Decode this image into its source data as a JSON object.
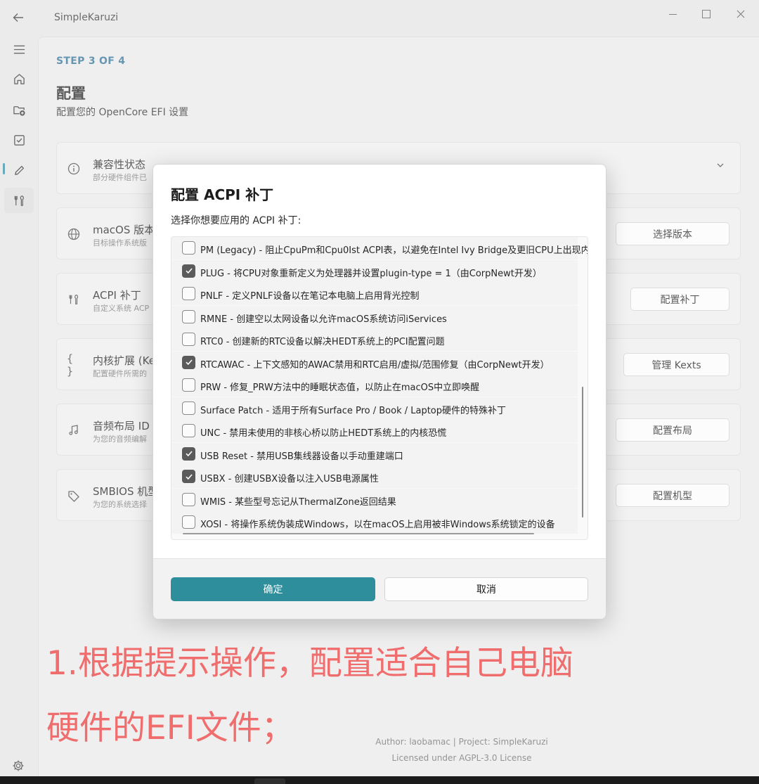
{
  "app": {
    "title": "SimpleKaruzi"
  },
  "page": {
    "step": "STEP 3 OF 4",
    "title": "配置",
    "subtitle": "配置您的 OpenCore EFI 设置"
  },
  "cards": [
    {
      "icon": "info-icon",
      "title": "兼容性状态",
      "desc": "部分硬件组件已"
    },
    {
      "icon": "globe-icon",
      "title": "macOS 版本",
      "desc": "目标操作系统版",
      "button": "选择版本"
    },
    {
      "icon": "tools-icon",
      "title": "ACPI 补丁",
      "desc": "自定义系统 ACP",
      "button": "配置补丁"
    },
    {
      "icon": "braces-icon",
      "title": "内核扩展 (Ke",
      "desc": "配置硬件所需的",
      "button": "管理 Kexts"
    },
    {
      "icon": "music-note-icon",
      "title": "音频布局 ID (",
      "desc": "为您的音频编解",
      "button": "配置布局"
    },
    {
      "icon": "tag-icon",
      "title": "SMBIOS 机型",
      "desc": "为您的系统选择",
      "button": "配置机型"
    }
  ],
  "footer": {
    "author": "Author: laobamac | Project: SimpleKaruzi",
    "license": "Licensed under AGPL-3.0 License"
  },
  "dialog": {
    "title": "配置 ACPI 补丁",
    "prompt": "选择你想要应用的 ACPI 补丁:",
    "patches": [
      {
        "label": "PM (Legacy) - 阻止CpuPm和Cpu0Ist ACPI表，以避免在Intel Ivy Bridge及更旧CPU上出现内",
        "checked": false
      },
      {
        "label": "PLUG - 将CPU对象重新定义为处理器并设置plugin-type = 1（由CorpNewt开发）",
        "checked": true
      },
      {
        "label": "PNLF - 定义PNLF设备以在笔记本电脑上启用背光控制",
        "checked": false
      },
      {
        "label": "RMNE - 创建空以太网设备以允许macOS系统访问iServices",
        "checked": false
      },
      {
        "label": "RTC0 - 创建新的RTC设备以解决HEDT系统上的PCI配置问题",
        "checked": false
      },
      {
        "label": "RTCAWAC - 上下文感知的AWAC禁用和RTC启用/虚拟/范围修复（由CorpNewt开发）",
        "checked": true
      },
      {
        "label": "PRW - 修复_PRW方法中的睡眠状态值，以防止在macOS中立即唤醒",
        "checked": false
      },
      {
        "label": "Surface Patch - 适用于所有Surface Pro / Book / Laptop硬件的特殊补丁",
        "checked": false
      },
      {
        "label": "UNC - 禁用未使用的非核心桥以防止HEDT系统上的内核恐慌",
        "checked": false
      },
      {
        "label": "USB Reset - 禁用USB集线器设备以手动重建端口",
        "checked": true
      },
      {
        "label": "USBX - 创建USBX设备以注入USB电源属性",
        "checked": true
      },
      {
        "label": "WMIS - 某些型号忘记从ThermalZone返回结果",
        "checked": false
      },
      {
        "label": "XOSI - 将操作系统伪装成Windows，以在macOS上启用被非Windows系统锁定的设备",
        "checked": false
      }
    ],
    "confirm": "确定",
    "cancel": "取消"
  },
  "annotation": {
    "line1": "1.根据提示操作，配置适合自己电脑",
    "line2": "硬件的EFI文件；"
  },
  "colors": {
    "accent": "#2e8e9c",
    "step": "#2a6e96",
    "annotation": "#f06d6d"
  }
}
